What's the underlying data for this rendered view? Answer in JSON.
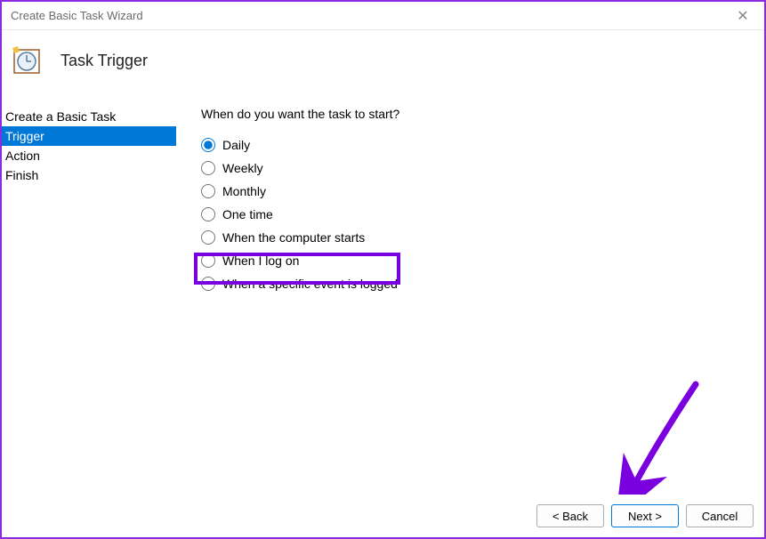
{
  "window": {
    "title": "Create Basic Task Wizard",
    "close_glyph": "✕"
  },
  "header": {
    "title": "Task Trigger"
  },
  "sidebar": {
    "items": [
      {
        "label": "Create a Basic Task",
        "selected": false
      },
      {
        "label": "Trigger",
        "selected": true
      },
      {
        "label": "Action",
        "selected": false
      },
      {
        "label": "Finish",
        "selected": false
      }
    ]
  },
  "main": {
    "prompt": "When do you want the task to start?",
    "options": [
      {
        "label": "Daily",
        "checked": true
      },
      {
        "label": "Weekly",
        "checked": false
      },
      {
        "label": "Monthly",
        "checked": false
      },
      {
        "label": "One time",
        "checked": false
      },
      {
        "label": "When the computer starts",
        "checked": false,
        "highlighted": true
      },
      {
        "label": "When I log on",
        "checked": false
      },
      {
        "label": "When a specific event is logged",
        "checked": false
      }
    ]
  },
  "footer": {
    "back": "< Back",
    "next": "Next >",
    "cancel": "Cancel"
  },
  "annotation": {
    "arrow_color": "#7a00e0"
  }
}
